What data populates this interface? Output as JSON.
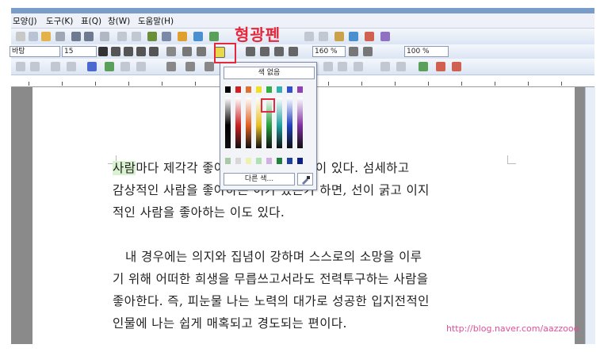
{
  "menu": [
    "모양(J)",
    "도구(K)",
    "표(Q)",
    "창(W)",
    "도움말(H)"
  ],
  "toolbar": {
    "font_name": "바탕",
    "font_size": "15",
    "zoom": "100 %",
    "line_spacing": "160 %"
  },
  "color_popup": {
    "no_color_label": "색 없음",
    "more_colors_label": "다른 색..."
  },
  "annotation": {
    "label": "형광펜",
    "color": "#e5283b"
  },
  "document": {
    "paragraph1": [
      "사람마다 제각각 좋아하는 사람의 유형이 있다. 섬세하고",
      "감상적인 사람을 좋아하는 이가 있는가 하면, 선이 굵고 이지",
      "적인 사람을  좋아하는 이도 있다."
    ],
    "highlighted_word": "사람",
    "paragraph2": [
      "내 경우에는 의지와 집념이 강하며 스스로의 소망을 이루",
      "기 위해 어떠한 희생을 무릅쓰고서라도 전력투구하는 사람을",
      "좋아한다. 즉, 피눈물 나는 노력의 대가로 성공한 입지전적인",
      "인물에 나는 쉽게 매혹되고 경도되는 편이다."
    ]
  },
  "watermark": "http://blog.naver.com/aazzooo"
}
